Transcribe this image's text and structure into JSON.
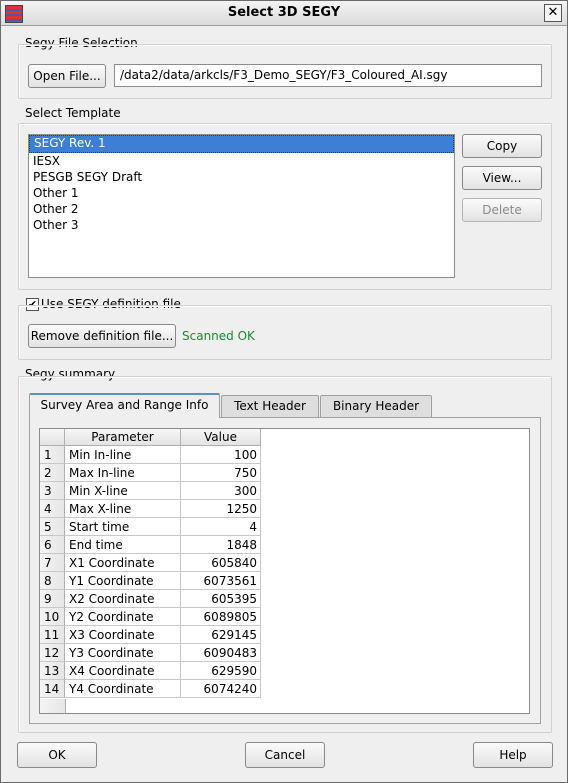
{
  "window": {
    "title": "Select 3D SEGY",
    "close_label": "✕"
  },
  "segy_file": {
    "group_label": "Segy File Selection",
    "open_button": "Open File...",
    "path": "/data2/data/arkcls/F3_Demo_SEGY/F3_Coloured_AI.sgy"
  },
  "template": {
    "group_label": "Select Template",
    "items": [
      "SEGY Rev. 1",
      "IESX",
      "PESGB SEGY Draft",
      "Other 1",
      "Other 2",
      "Other 3"
    ],
    "selected": "SEGY Rev. 1",
    "copy_button": "Copy",
    "view_button": "View...",
    "delete_button": "Delete"
  },
  "definition": {
    "checkbox_label": "Use SEGY definition file",
    "checked": true,
    "remove_button": "Remove definition file...",
    "status": "Scanned OK",
    "status_color": "#1d8a2a"
  },
  "summary": {
    "group_label": "Segy summary",
    "tabs": [
      "Survey Area and Range Info",
      "Text Header",
      "Binary Header"
    ],
    "active_tab": "Survey Area and Range Info",
    "columns": [
      "Parameter",
      "Value"
    ],
    "rows": [
      {
        "num": "1",
        "param": "Min In-line",
        "value": "100"
      },
      {
        "num": "2",
        "param": "Max In-line",
        "value": "750"
      },
      {
        "num": "3",
        "param": "Min X-line",
        "value": "300"
      },
      {
        "num": "4",
        "param": "Max X-line",
        "value": "1250"
      },
      {
        "num": "5",
        "param": "Start time",
        "value": "4"
      },
      {
        "num": "6",
        "param": "End time",
        "value": "1848"
      },
      {
        "num": "7",
        "param": "X1 Coordinate",
        "value": "605840"
      },
      {
        "num": "8",
        "param": "Y1 Coordinate",
        "value": "6073561"
      },
      {
        "num": "9",
        "param": "X2 Coordinate",
        "value": "605395"
      },
      {
        "num": "10",
        "param": "Y2 Coordinate",
        "value": "6089805"
      },
      {
        "num": "11",
        "param": "X3 Coordinate",
        "value": "629145"
      },
      {
        "num": "12",
        "param": "Y3 Coordinate",
        "value": "6090483"
      },
      {
        "num": "13",
        "param": "X4 Coordinate",
        "value": "629590"
      },
      {
        "num": "14",
        "param": "Y4 Coordinate",
        "value": "6074240"
      }
    ]
  },
  "footer": {
    "ok_button": "OK",
    "cancel_button": "Cancel",
    "help_button": "Help"
  },
  "colors": {
    "selection": "#3d7fd6",
    "active_tab_accent": "#5a8fd6"
  },
  "icons": {
    "app": "segy-app-icon",
    "close": "close-icon",
    "check": "checkmark-icon"
  }
}
